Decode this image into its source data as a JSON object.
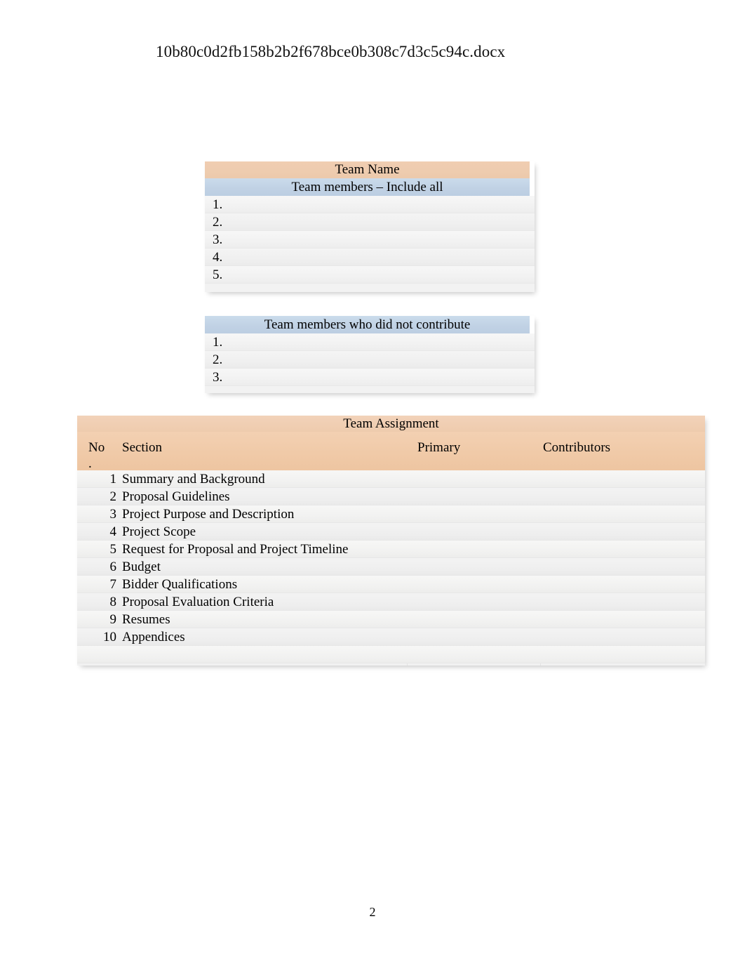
{
  "document": {
    "filename": "10b80c0d2fb158b2b2f678bce0b308c7d3c5c94c.docx",
    "page_number": "2"
  },
  "colors": {
    "header_orange": "#EECCAF",
    "header_blue": "#BFD0E3",
    "row_light": "#F4F4F4",
    "page_background": "#FFFFFF",
    "text": "#000000"
  },
  "team_name_table": {
    "title": "Team Name",
    "subheader": "Team members – Include all",
    "members": [
      {
        "index": "1.",
        "value": ""
      },
      {
        "index": "2.",
        "value": ""
      },
      {
        "index": "3.",
        "value": ""
      },
      {
        "index": "4.",
        "value": ""
      },
      {
        "index": "5.",
        "value": ""
      }
    ]
  },
  "no_contribute_table": {
    "header": "Team members who did not contribute",
    "members": [
      {
        "index": "1.",
        "value": ""
      },
      {
        "index": "2.",
        "value": ""
      },
      {
        "index": "3.",
        "value": ""
      }
    ]
  },
  "team_assignment_table": {
    "title": "Team Assignment",
    "columns": {
      "no_line1": "No",
      "no_line2": ".",
      "section": "Section",
      "primary": "Primary",
      "contributors": "Contributors"
    },
    "rows": [
      {
        "no": "1",
        "section": "Summary and Background",
        "primary": "",
        "contributors": ""
      },
      {
        "no": "2",
        "section": "Proposal Guidelines",
        "primary": "",
        "contributors": ""
      },
      {
        "no": "3",
        "section": "Project Purpose and Description",
        "primary": "",
        "contributors": ""
      },
      {
        "no": "4",
        "section": "Project Scope",
        "primary": "",
        "contributors": ""
      },
      {
        "no": "5",
        "section": "Request for Proposal and Project Timeline",
        "primary": "",
        "contributors": ""
      },
      {
        "no": "6",
        "section": "Budget",
        "primary": "",
        "contributors": ""
      },
      {
        "no": "7",
        "section": "Bidder Qualifications",
        "primary": "",
        "contributors": ""
      },
      {
        "no": "8",
        "section": "Proposal Evaluation Criteria",
        "primary": "",
        "contributors": ""
      },
      {
        "no": "9",
        "section": "Resumes",
        "primary": "",
        "contributors": ""
      },
      {
        "no": "10",
        "section": "Appendices",
        "primary": "",
        "contributors": ""
      },
      {
        "no": "",
        "section": "",
        "primary": "",
        "contributors": ""
      }
    ]
  }
}
